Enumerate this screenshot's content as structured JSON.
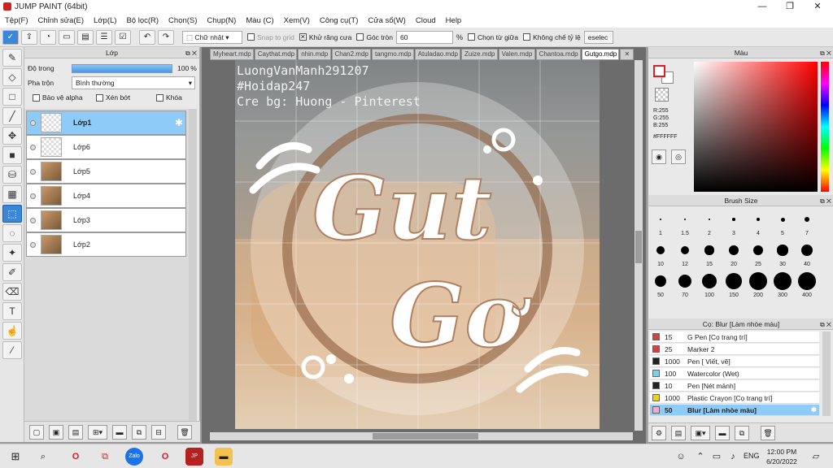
{
  "window": {
    "title": "JUMP PAINT (64bit)",
    "minimize": "—",
    "maximize": "❐",
    "close": "✕"
  },
  "menu": [
    "Tệp(F)",
    "Chỉnh sửa(E)",
    "Lớp(L)",
    "Bộ lọc(R)",
    "Chọn(S)",
    "Chụp(N)",
    "Màu (C)",
    "Xem(V)",
    "Công cụ(T)",
    "Cửa sổ(W)",
    "Cloud",
    "Help"
  ],
  "toolbar": {
    "shape_select": "Chữ nhật",
    "snap_to_grid": "Snap to grid",
    "anti_alias": "Khử răng cưa",
    "round_corner": "Góc tròn",
    "round_value": "60",
    "percent": "%",
    "select_center": "Chọn từ giữa",
    "fixed_ratio": "Không chế tỷ lệ",
    "deselect": "eselec"
  },
  "layers_panel": {
    "title": "Lớp",
    "opacity_label": "Độ trong",
    "opacity_value": "100",
    "opacity_unit": "%",
    "blend_label": "Pha trộn",
    "blend_value": "Bình thường",
    "protect_alpha": "Bảo vệ alpha",
    "clip": "Xén bớt",
    "lock": "Khóa",
    "layers": [
      {
        "name": "Lớp1",
        "selected": true,
        "thumb": "empty"
      },
      {
        "name": "Lớp6",
        "selected": false,
        "thumb": "empty"
      },
      {
        "name": "Lớp5",
        "selected": false,
        "thumb": "cat"
      },
      {
        "name": "Lớp4",
        "selected": false,
        "thumb": "cat"
      },
      {
        "name": "Lớp3",
        "selected": false,
        "thumb": "cat"
      },
      {
        "name": "Lớp2",
        "selected": false,
        "thumb": "cat"
      }
    ]
  },
  "tabs": [
    "Myheart.mdp",
    "Caythat.mdp",
    "nhin.mdp",
    "Chan2.mdp",
    "tangmo.mdp",
    "Atuladao.mdp",
    "Zuize.mdp",
    "Valen.mdp",
    "Chantoa.mdp",
    "Gutgo.mdp"
  ],
  "active_tab": "Gutgo.mdp",
  "artwork": {
    "credit_1": "LuongVanManh291207",
    "credit_2": "#Hoidap247",
    "credit_3": "Cre bg: Huong - Pinterest",
    "word_1": "Gut",
    "word_2": "Gơ"
  },
  "color_panel": {
    "title": "Màu",
    "r": "R:255",
    "g": "G:255",
    "b": "B:255",
    "hex": "#FFFFFF",
    "primary_color": "#ff0000"
  },
  "brush_size_panel": {
    "title": "Brush Size",
    "sizes": [
      "1",
      "1.5",
      "2",
      "3",
      "4",
      "5",
      "7",
      "10",
      "12",
      "15",
      "20",
      "25",
      "30",
      "40",
      "50",
      "70",
      "100",
      "150",
      "200",
      "300",
      "400"
    ]
  },
  "brush_list": {
    "title": "Cọ: Blur [Làm nhòe màu]",
    "items": [
      {
        "size": "15",
        "name": "G Pen [Cọ trang trí]",
        "color": "#e23b3b",
        "selected": false
      },
      {
        "size": "25",
        "name": "Marker 2",
        "color": "#e23b3b",
        "selected": false
      },
      {
        "size": "1000",
        "name": "Pen [ Viết, vẽ]",
        "color": "#222222",
        "selected": false
      },
      {
        "size": "100",
        "name": "Watercolor (Wet)",
        "color": "#7ecfe8",
        "selected": false
      },
      {
        "size": "10",
        "name": "Pen [Nét mảnh]",
        "color": "#222222",
        "selected": false
      },
      {
        "size": "1000",
        "name": "Plastic Crayon [Cọ trang trí]",
        "color": "#e8d21a",
        "selected": false
      },
      {
        "size": "50",
        "name": "Blur [Làm nhòe màu]",
        "color": "#f3a6d8",
        "selected": true
      }
    ]
  },
  "taskbar": {
    "time": "12:00 PM",
    "date": "6/20/2022",
    "lang": "ENG"
  }
}
